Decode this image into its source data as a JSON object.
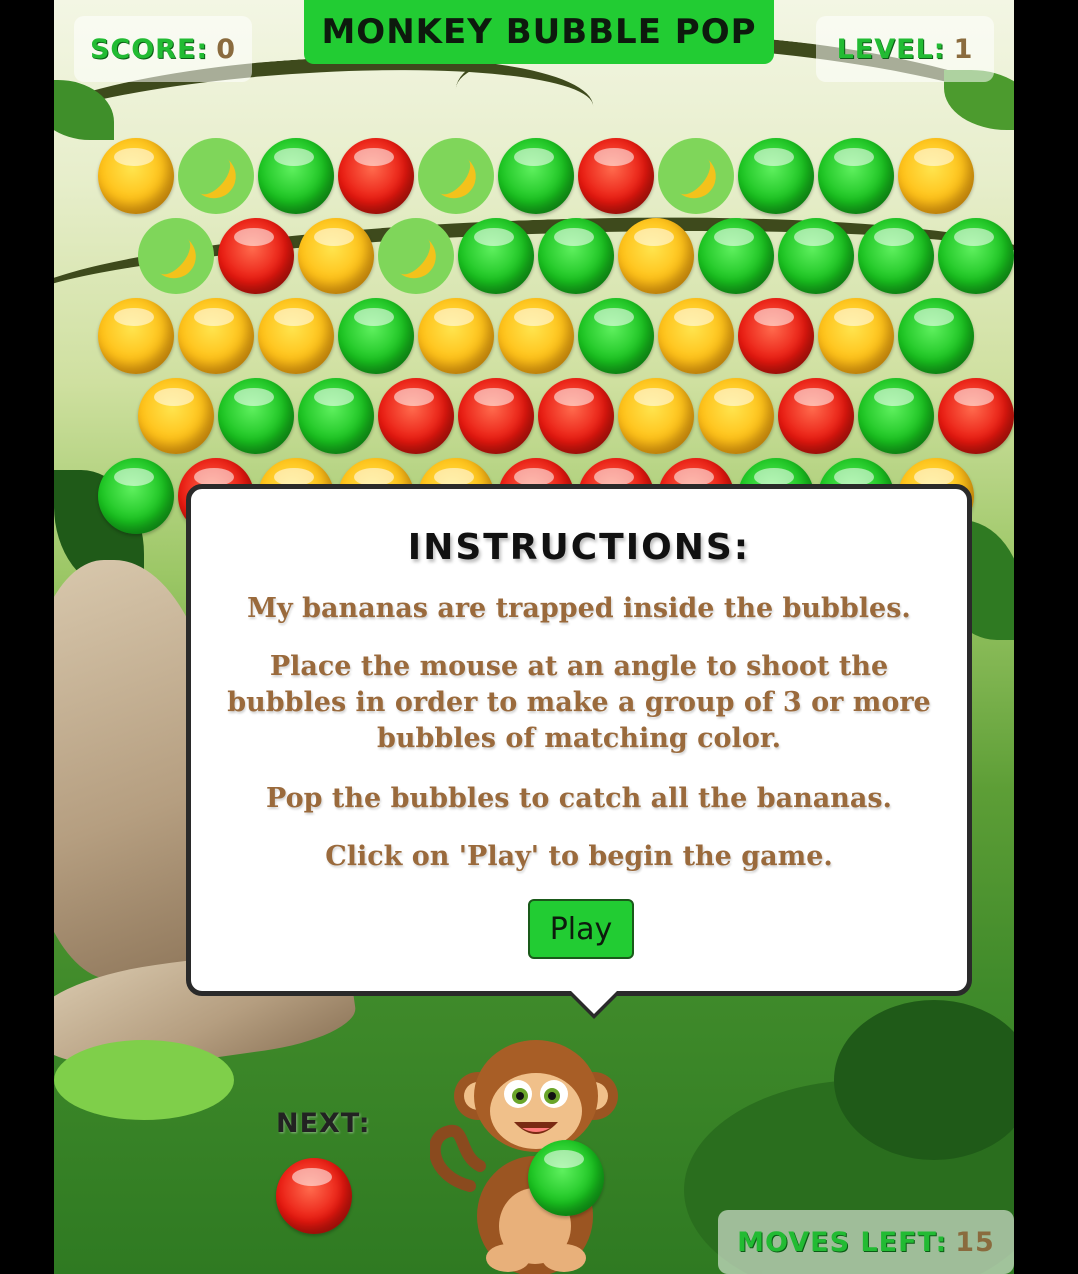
{
  "header": {
    "title": "MONKEY BUBBLE POP",
    "score_label": "SCORE:",
    "score_value": "0",
    "level_label": "LEVEL:",
    "level_value": "1"
  },
  "grid": {
    "rows": [
      [
        "yellow",
        "banana",
        "green",
        "red",
        "banana",
        "green",
        "red",
        "banana",
        "green",
        "green",
        "yellow"
      ],
      [
        "banana",
        "red",
        "yellow",
        "banana",
        "green",
        "green",
        "yellow",
        "green",
        "green",
        "green",
        "green"
      ],
      [
        "yellow",
        "yellow",
        "yellow",
        "green",
        "yellow",
        "yellow",
        "green",
        "yellow",
        "red",
        "yellow",
        "green"
      ],
      [
        "yellow",
        "green",
        "green",
        "red",
        "red",
        "red",
        "yellow",
        "yellow",
        "red",
        "green",
        "red"
      ],
      [
        "green",
        "red",
        "yellow",
        "yellow",
        "yellow",
        "red",
        "red",
        "red",
        "green",
        "green",
        "yellow"
      ]
    ]
  },
  "modal": {
    "title": "INSTRUCTIONS:",
    "paragraphs": [
      "My bananas are trapped inside the bubbles.",
      "Place the mouse at an angle to shoot the bubbles in order to make a group of 3 or more bubbles of matching color.",
      "Pop the bubbles to catch all the bananas.",
      "Click on 'Play' to begin the game."
    ],
    "play_label": "Play"
  },
  "footer": {
    "next_label": "NEXT:",
    "next_bubble": "red",
    "current_bubble": "green",
    "moves_label": "MOVES LEFT:",
    "moves_value": "15"
  },
  "colors": {
    "accent_green": "#22cc33",
    "text_brown": "#9a6a3c"
  }
}
